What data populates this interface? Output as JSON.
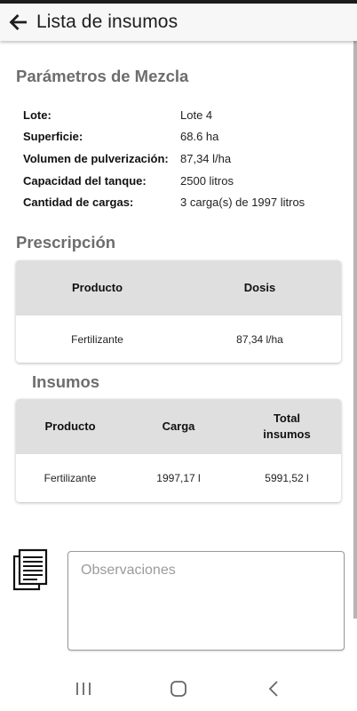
{
  "app_bar": {
    "title": "Lista de insumos",
    "back_icon": "arrow-left-icon"
  },
  "mix_params": {
    "title": "Parámetros de Mezcla",
    "rows": [
      {
        "label": "Lote:",
        "value": "Lote 4"
      },
      {
        "label": "Superficie:",
        "value": "68.6 ha"
      },
      {
        "label": "Volumen de pulverización:",
        "value": "87,34 l/ha"
      },
      {
        "label": "Capacidad del tanque:",
        "value": "2500 litros"
      },
      {
        "label": "Cantidad de cargas:",
        "value": "3 carga(s) de 1997 litros"
      }
    ]
  },
  "prescription": {
    "title": "Prescripción",
    "headers": [
      "Producto",
      "Dosis"
    ],
    "rows": [
      [
        "Fertilizante",
        "87,34 l/ha"
      ]
    ]
  },
  "supplies": {
    "title": "Insumos",
    "headers": [
      "Producto",
      "Carga",
      "Total insumos"
    ],
    "rows": [
      [
        "Fertilizante",
        "1997,17 l",
        "5991,52 l"
      ]
    ]
  },
  "notes": {
    "icon": "document-copies-icon",
    "placeholder": "Observaciones",
    "value": ""
  },
  "nav_bar": {
    "recents_icon": "recents-icon",
    "home_icon": "home-icon",
    "back_icon": "back-chevron-icon"
  },
  "colors": {
    "section_title": "#6d6d6d",
    "table_header_bg": "#dfdfdf",
    "app_bar_bg": "#f7f7f7"
  }
}
